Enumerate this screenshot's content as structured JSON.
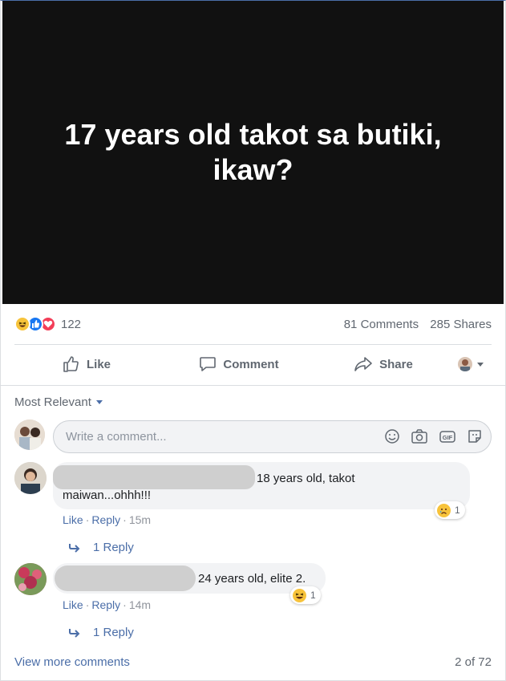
{
  "post": {
    "image_text": "17 years old takot sa butiki, ikaw?"
  },
  "stats": {
    "reaction_count": "122",
    "comments": "81 Comments",
    "shares": "285 Shares",
    "reaction_icons": [
      "haha-icon",
      "like-icon",
      "love-icon"
    ]
  },
  "actions": {
    "like": "Like",
    "comment": "Comment",
    "share": "Share"
  },
  "comments_section": {
    "sort_label": "Most Relevant",
    "input_placeholder": "Write a comment...",
    "comments": [
      {
        "text_line1": "18 years old, takot",
        "text_line2": "maiwan...ohhh!!!",
        "reaction_count": "1",
        "reaction_icon": "sad-icon",
        "like": "Like",
        "reply": "Reply",
        "time": "15m",
        "replies": "1 Reply"
      },
      {
        "text_line1": "24 years old, elite 2.",
        "reaction_count": "1",
        "reaction_icon": "haha-icon",
        "like": "Like",
        "reply": "Reply",
        "time": "14m",
        "replies": "1 Reply"
      }
    ],
    "view_more": "View more comments",
    "pager": "2 of 72"
  },
  "colors": {
    "link": "#4b6ea8",
    "muted": "#606770",
    "bubble": "#f2f3f5",
    "media_bg": "#111111"
  }
}
